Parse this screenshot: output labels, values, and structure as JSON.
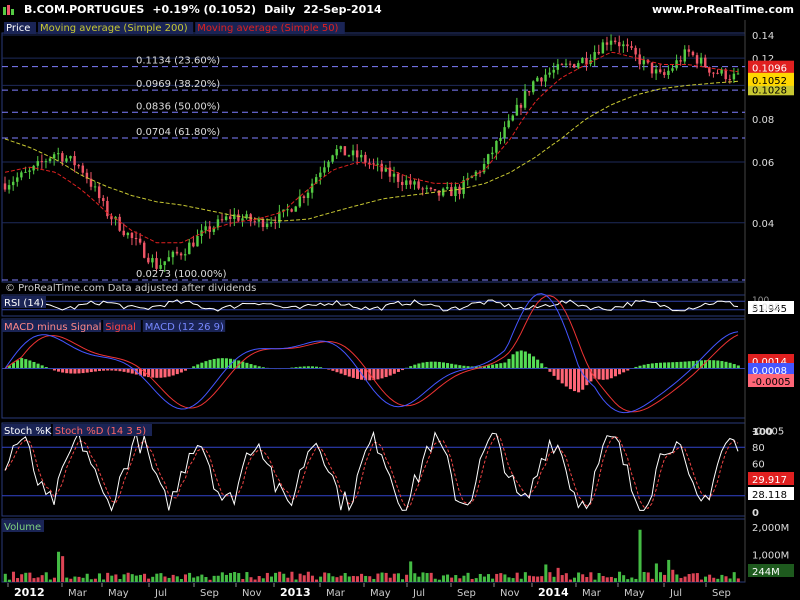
{
  "header": {
    "symbol": "B.COM.PORTUGUES",
    "change": "+0.19% (0.1052)",
    "period": "Daily",
    "date": "22-Sep-2014",
    "site": "www.ProRealTime.com",
    "copyright": "© ProRealTime.com  Data adjusted after dividends"
  },
  "colors": {
    "background": "#000000",
    "grid": "#1e2a5a",
    "up_candle": "#55cc44",
    "down_candle": "#ee5566",
    "ma200": "#c8c832",
    "ma50": "#e02020",
    "fib_line": "#7f7fff",
    "volume_up": "#44bb44",
    "volume_down": "#dd4455"
  },
  "price_panel": {
    "legend": [
      "Price",
      "Moving average (Simple 200)",
      "Moving average (Simple 50)"
    ],
    "y_ticks": [
      "0.14",
      "0.12",
      "0.10",
      "0.08",
      "0.06",
      "0.04"
    ],
    "last_price": "0.1052",
    "ma200_label": "0.1028",
    "ma50_label": "0.1096",
    "fib_levels": [
      {
        "label": "0.1134 (23.60%)",
        "value": 0.1134
      },
      {
        "label": "0.0969 (38.20%)",
        "value": 0.0969
      },
      {
        "label": "0.0836 (50.00%)",
        "value": 0.0836
      },
      {
        "label": "0.0704 (61.80%)",
        "value": 0.0704
      },
      {
        "label": "0.0273 (100.00%)",
        "value": 0.0273
      }
    ]
  },
  "rsi_panel": {
    "legend": "RSI (14)",
    "value": "51.945",
    "top_label": "100"
  },
  "macd_panel": {
    "legend": [
      "MACD minus Signal",
      "Signal",
      "MACD (12 26 9)"
    ],
    "y_ticks": [
      "0.005",
      "0",
      "-0.005"
    ],
    "values": [
      "0.0014",
      "0.0008",
      "-0.0005"
    ]
  },
  "stoch_panel": {
    "legend": [
      "Stoch %K",
      "Stoch %D (14 3 5)"
    ],
    "y_ticks": [
      "100",
      "80",
      "60",
      "40",
      "20",
      "0"
    ],
    "values": [
      "29.917",
      "28.118"
    ]
  },
  "volume_panel": {
    "legend": "Volume",
    "y_ticks": [
      "2,000M",
      "1,000M"
    ],
    "value": "244M"
  },
  "x_axis": {
    "labels": [
      "2012",
      "Mar",
      "May",
      "Jul",
      "Sep",
      "Nov",
      "2013",
      "Mar",
      "May",
      "Jul",
      "Sep",
      "Nov",
      "2014",
      "Mar",
      "May",
      "Jul",
      "Sep"
    ],
    "bold": [
      "2012",
      "2013",
      "2014"
    ]
  },
  "chart_data": {
    "type": "candlestick",
    "series": [
      {
        "name": "Price",
        "values": [
          0.052,
          0.056,
          0.064,
          0.058,
          0.043,
          0.036,
          0.03,
          0.033,
          0.038,
          0.042,
          0.04,
          0.042,
          0.05,
          0.065,
          0.062,
          0.056,
          0.052,
          0.048,
          0.05,
          0.059,
          0.078,
          0.105,
          0.112,
          0.12,
          0.138,
          0.12,
          0.105,
          0.125,
          0.11,
          0.1052
        ]
      },
      {
        "name": "Moving average (Simple 200)",
        "values": [
          0.07,
          0.066,
          0.061,
          0.055,
          0.051,
          0.048,
          0.046,
          0.045,
          0.0435,
          0.042,
          0.041,
          0.0405,
          0.041,
          0.043,
          0.045,
          0.047,
          0.048,
          0.049,
          0.05,
          0.052,
          0.056,
          0.062,
          0.07,
          0.08,
          0.088,
          0.094,
          0.098,
          0.1,
          0.1015,
          0.1028
        ]
      },
      {
        "name": "Moving average (Simple 50)",
        "values": [
          0.056,
          0.058,
          0.056,
          0.05,
          0.043,
          0.038,
          0.035,
          0.035,
          0.038,
          0.04,
          0.041,
          0.043,
          0.05,
          0.057,
          0.06,
          0.058,
          0.054,
          0.052,
          0.052,
          0.057,
          0.07,
          0.09,
          0.105,
          0.115,
          0.125,
          0.12,
          0.115,
          0.115,
          0.112,
          0.1096
        ]
      }
    ],
    "ylim": [
      0.0273,
      0.14
    ],
    "scale": "log",
    "x_labels": [
      "2012",
      "Mar",
      "May",
      "Jul",
      "Sep",
      "Nov",
      "2013",
      "Mar",
      "May",
      "Jul",
      "Sep",
      "Nov",
      "2014",
      "Mar",
      "May",
      "Jul",
      "Sep"
    ]
  }
}
